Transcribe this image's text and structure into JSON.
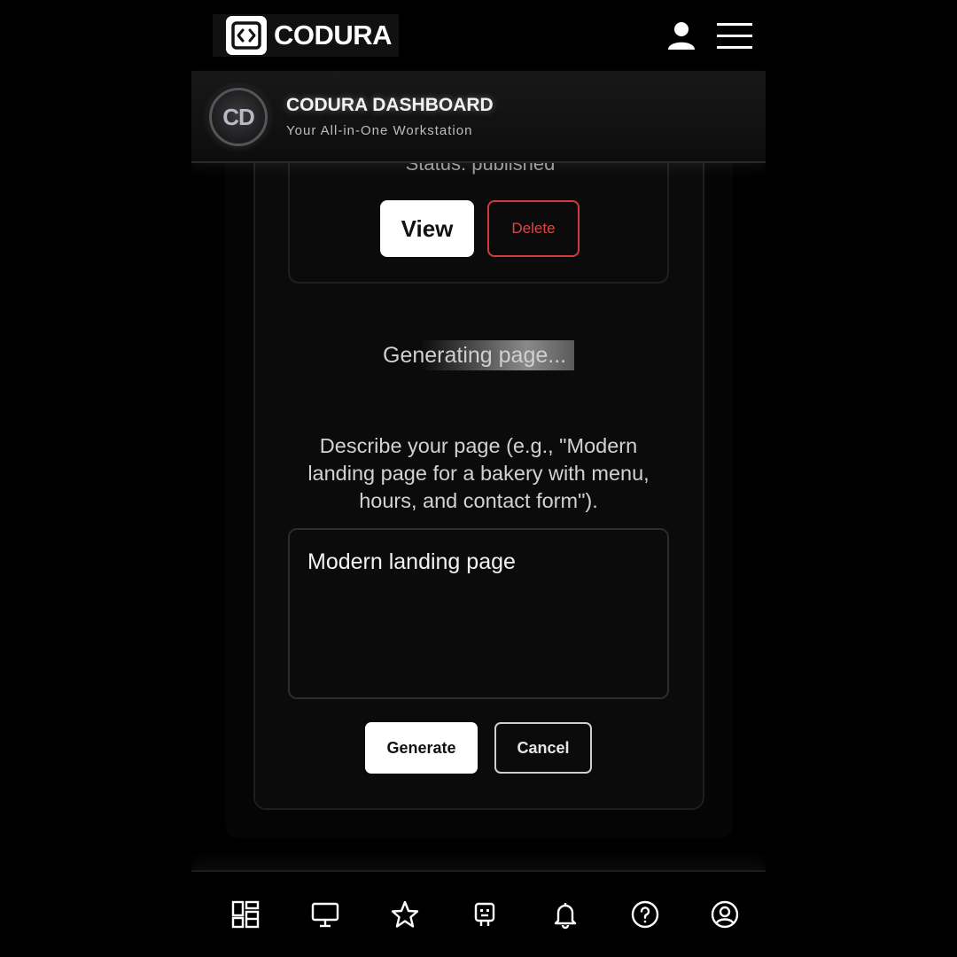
{
  "brand": {
    "name": "CODURA",
    "logo_icon": "code-brackets-icon"
  },
  "topbar": {
    "user_icon": "user-icon",
    "menu_icon": "hamburger-menu-icon"
  },
  "dashboard": {
    "avatar_initials": "CD",
    "title": "CODURA DASHBOARD",
    "subtitle": "Your All-in-One Workstation"
  },
  "page_card": {
    "status": "Status: published",
    "view_label": "View",
    "delete_label": "Delete"
  },
  "generator": {
    "loading_text": "Generating page...",
    "description": "Describe your page (e.g., \"Modern landing page for a bakery with menu, hours, and contact form\").",
    "prompt_value": "Modern landing page",
    "generate_label": "Generate",
    "cancel_label": "Cancel"
  },
  "bottom_nav": [
    {
      "icon": "dashboard-grid-icon"
    },
    {
      "icon": "monitor-icon"
    },
    {
      "icon": "star-icon"
    },
    {
      "icon": "robot-icon"
    },
    {
      "icon": "bell-icon"
    },
    {
      "icon": "help-circle-icon"
    },
    {
      "icon": "account-circle-icon"
    }
  ],
  "colors": {
    "background": "#000000",
    "accent_danger": "#e04646",
    "primary_button": "#ffffff"
  }
}
